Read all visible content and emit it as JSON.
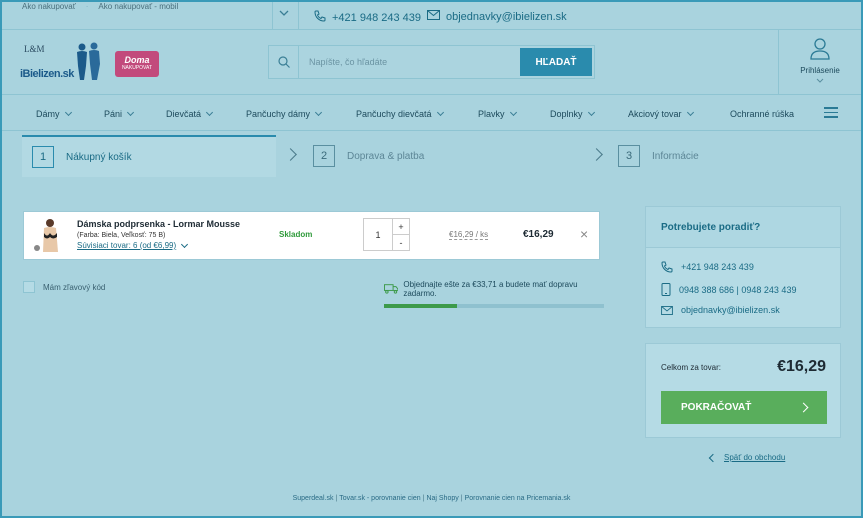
{
  "topbar": {
    "links": [
      "Ako nakupovať",
      "Ako nakupovať - mobil"
    ],
    "phone": "+421 948 243 439",
    "email": "objednavky@ibielizen.sk"
  },
  "header": {
    "logo_lm": "L&M",
    "logo_brand": "iBielizen.sk",
    "doma_badge": "Doma",
    "doma_sub": "NAKUPOVAT",
    "search_placeholder": "Napíšte, čo hľadáte",
    "search_button": "HĽADAŤ",
    "login_label": "Prihlásenie"
  },
  "nav": {
    "items": [
      "Dámy",
      "Páni",
      "Dievčatá",
      "Pančuchy dámy",
      "Pančuchy dievčatá",
      "Plavky",
      "Doplnky",
      "Akciový tovar",
      "Ochranné rúška"
    ]
  },
  "steps": [
    {
      "num": "1",
      "label": "Nákupný košík"
    },
    {
      "num": "2",
      "label": "Doprava & platba"
    },
    {
      "num": "3",
      "label": "Informácie"
    }
  ],
  "cart": {
    "product_name": "Dámska podprsenka - Lormar Mousse",
    "product_meta": "(Farba: Biela, Veľkosť: 75 B)",
    "related_link": "Súvisiaci tovar: 6 (od €6,99)",
    "stock": "Skladom",
    "quantity": "1",
    "qty_plus": "+",
    "qty_minus": "-",
    "unit_price": "€16,29 / ks",
    "price": "€16,29",
    "remove": "×"
  },
  "coupon": {
    "label": "Mám zľavový kód"
  },
  "shipping": {
    "message": "Objednajte ešte za €33,71 a budete mať dopravu zadarmo.",
    "progress": 0.33
  },
  "help": {
    "title": "Potrebujete poradiť?",
    "phone": "+421 948 243 439",
    "mobile": "0948 388 686 | 0948 243 439",
    "email": "objednavky@ibielizen.sk"
  },
  "total": {
    "label": "Celkom za tovar:",
    "amount": "€16,29",
    "cta": "POKRAČOVAŤ"
  },
  "back_link": "Späť do obchodu",
  "footer": {
    "links": [
      "Superdeal.sk",
      "Tovar.sk - porovnanie cien",
      "Naj Shopy",
      "Porovnanie cien na Pricemania.sk"
    ]
  },
  "colors": {
    "accent": "#2a8bad",
    "success": "#59ae5c",
    "brand_pink": "#c24a7c"
  }
}
